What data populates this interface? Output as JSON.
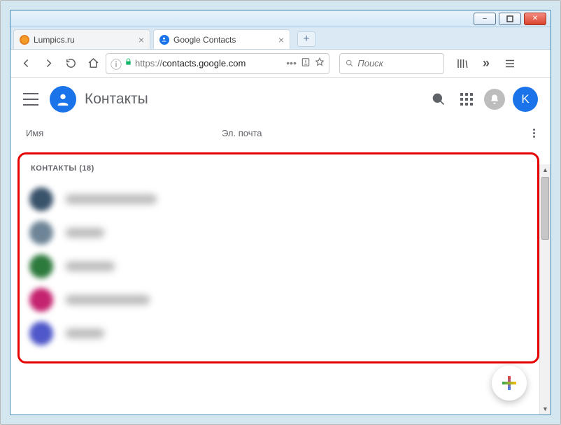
{
  "window": {
    "minimize": "–",
    "maximize": "□",
    "close": "✕"
  },
  "tabs": [
    {
      "title": "Lumpics.ru",
      "favicon_color": "#f59b27",
      "active": false
    },
    {
      "title": "Google Contacts",
      "favicon_color": "#1a73e8",
      "active": true
    }
  ],
  "newtab_label": "+",
  "url": {
    "info_icon": "ⓘ",
    "lock_color": "#12b76a",
    "host_prefix": "https://",
    "host_bold": "contacts.google.com",
    "more": "•••",
    "reader": "☰"
  },
  "search": {
    "icon": "Q",
    "placeholder": "Поиск"
  },
  "nav_right": {
    "library": "|||\\",
    "overflow": "»",
    "menu": "≡"
  },
  "app": {
    "title": "Контакты",
    "avatar_letter": "K"
  },
  "columns": {
    "name": "Имя",
    "email": "Эл. почта"
  },
  "section_label": "КОНТАКТЫ (18)",
  "contacts": [
    {
      "avatar_color": "#39536b",
      "name_width": 130
    },
    {
      "avatar_color": "#6d8597",
      "name_width": 55
    },
    {
      "avatar_color": "#2d7a3d",
      "name_width": 70
    },
    {
      "avatar_color": "#c4236f",
      "name_width": 120
    },
    {
      "avatar_color": "#4f58c9",
      "name_width": 55
    }
  ],
  "fab_label": "+"
}
